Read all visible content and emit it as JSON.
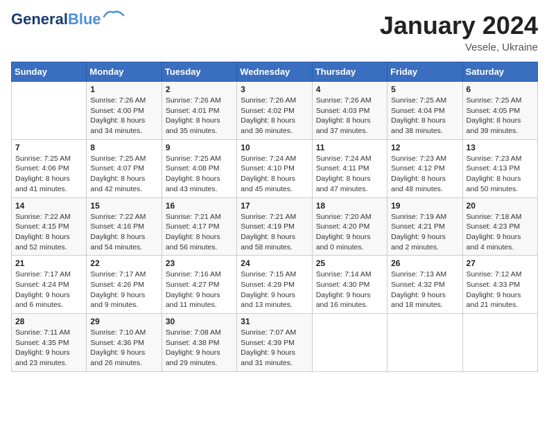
{
  "header": {
    "logo_line1": "General",
    "logo_line2": "Blue",
    "month": "January 2024",
    "location": "Vesele, Ukraine"
  },
  "days_of_week": [
    "Sunday",
    "Monday",
    "Tuesday",
    "Wednesday",
    "Thursday",
    "Friday",
    "Saturday"
  ],
  "weeks": [
    [
      {
        "day": "",
        "info": ""
      },
      {
        "day": "1",
        "info": "Sunrise: 7:26 AM\nSunset: 4:00 PM\nDaylight: 8 hours\nand 34 minutes."
      },
      {
        "day": "2",
        "info": "Sunrise: 7:26 AM\nSunset: 4:01 PM\nDaylight: 8 hours\nand 35 minutes."
      },
      {
        "day": "3",
        "info": "Sunrise: 7:26 AM\nSunset: 4:02 PM\nDaylight: 8 hours\nand 36 minutes."
      },
      {
        "day": "4",
        "info": "Sunrise: 7:26 AM\nSunset: 4:03 PM\nDaylight: 8 hours\nand 37 minutes."
      },
      {
        "day": "5",
        "info": "Sunrise: 7:25 AM\nSunset: 4:04 PM\nDaylight: 8 hours\nand 38 minutes."
      },
      {
        "day": "6",
        "info": "Sunrise: 7:25 AM\nSunset: 4:05 PM\nDaylight: 8 hours\nand 39 minutes."
      }
    ],
    [
      {
        "day": "7",
        "info": "Sunrise: 7:25 AM\nSunset: 4:06 PM\nDaylight: 8 hours\nand 41 minutes."
      },
      {
        "day": "8",
        "info": "Sunrise: 7:25 AM\nSunset: 4:07 PM\nDaylight: 8 hours\nand 42 minutes."
      },
      {
        "day": "9",
        "info": "Sunrise: 7:25 AM\nSunset: 4:08 PM\nDaylight: 8 hours\nand 43 minutes."
      },
      {
        "day": "10",
        "info": "Sunrise: 7:24 AM\nSunset: 4:10 PM\nDaylight: 8 hours\nand 45 minutes."
      },
      {
        "day": "11",
        "info": "Sunrise: 7:24 AM\nSunset: 4:11 PM\nDaylight: 8 hours\nand 47 minutes."
      },
      {
        "day": "12",
        "info": "Sunrise: 7:23 AM\nSunset: 4:12 PM\nDaylight: 8 hours\nand 48 minutes."
      },
      {
        "day": "13",
        "info": "Sunrise: 7:23 AM\nSunset: 4:13 PM\nDaylight: 8 hours\nand 50 minutes."
      }
    ],
    [
      {
        "day": "14",
        "info": "Sunrise: 7:22 AM\nSunset: 4:15 PM\nDaylight: 8 hours\nand 52 minutes."
      },
      {
        "day": "15",
        "info": "Sunrise: 7:22 AM\nSunset: 4:16 PM\nDaylight: 8 hours\nand 54 minutes."
      },
      {
        "day": "16",
        "info": "Sunrise: 7:21 AM\nSunset: 4:17 PM\nDaylight: 8 hours\nand 56 minutes."
      },
      {
        "day": "17",
        "info": "Sunrise: 7:21 AM\nSunset: 4:19 PM\nDaylight: 8 hours\nand 58 minutes."
      },
      {
        "day": "18",
        "info": "Sunrise: 7:20 AM\nSunset: 4:20 PM\nDaylight: 9 hours\nand 0 minutes."
      },
      {
        "day": "19",
        "info": "Sunrise: 7:19 AM\nSunset: 4:21 PM\nDaylight: 9 hours\nand 2 minutes."
      },
      {
        "day": "20",
        "info": "Sunrise: 7:18 AM\nSunset: 4:23 PM\nDaylight: 9 hours\nand 4 minutes."
      }
    ],
    [
      {
        "day": "21",
        "info": "Sunrise: 7:17 AM\nSunset: 4:24 PM\nDaylight: 9 hours\nand 6 minutes."
      },
      {
        "day": "22",
        "info": "Sunrise: 7:17 AM\nSunset: 4:26 PM\nDaylight: 9 hours\nand 9 minutes."
      },
      {
        "day": "23",
        "info": "Sunrise: 7:16 AM\nSunset: 4:27 PM\nDaylight: 9 hours\nand 11 minutes."
      },
      {
        "day": "24",
        "info": "Sunrise: 7:15 AM\nSunset: 4:29 PM\nDaylight: 9 hours\nand 13 minutes."
      },
      {
        "day": "25",
        "info": "Sunrise: 7:14 AM\nSunset: 4:30 PM\nDaylight: 9 hours\nand 16 minutes."
      },
      {
        "day": "26",
        "info": "Sunrise: 7:13 AM\nSunset: 4:32 PM\nDaylight: 9 hours\nand 18 minutes."
      },
      {
        "day": "27",
        "info": "Sunrise: 7:12 AM\nSunset: 4:33 PM\nDaylight: 9 hours\nand 21 minutes."
      }
    ],
    [
      {
        "day": "28",
        "info": "Sunrise: 7:11 AM\nSunset: 4:35 PM\nDaylight: 9 hours\nand 23 minutes."
      },
      {
        "day": "29",
        "info": "Sunrise: 7:10 AM\nSunset: 4:36 PM\nDaylight: 9 hours\nand 26 minutes."
      },
      {
        "day": "30",
        "info": "Sunrise: 7:08 AM\nSunset: 4:38 PM\nDaylight: 9 hours\nand 29 minutes."
      },
      {
        "day": "31",
        "info": "Sunrise: 7:07 AM\nSunset: 4:39 PM\nDaylight: 9 hours\nand 31 minutes."
      },
      {
        "day": "",
        "info": ""
      },
      {
        "day": "",
        "info": ""
      },
      {
        "day": "",
        "info": ""
      }
    ]
  ]
}
